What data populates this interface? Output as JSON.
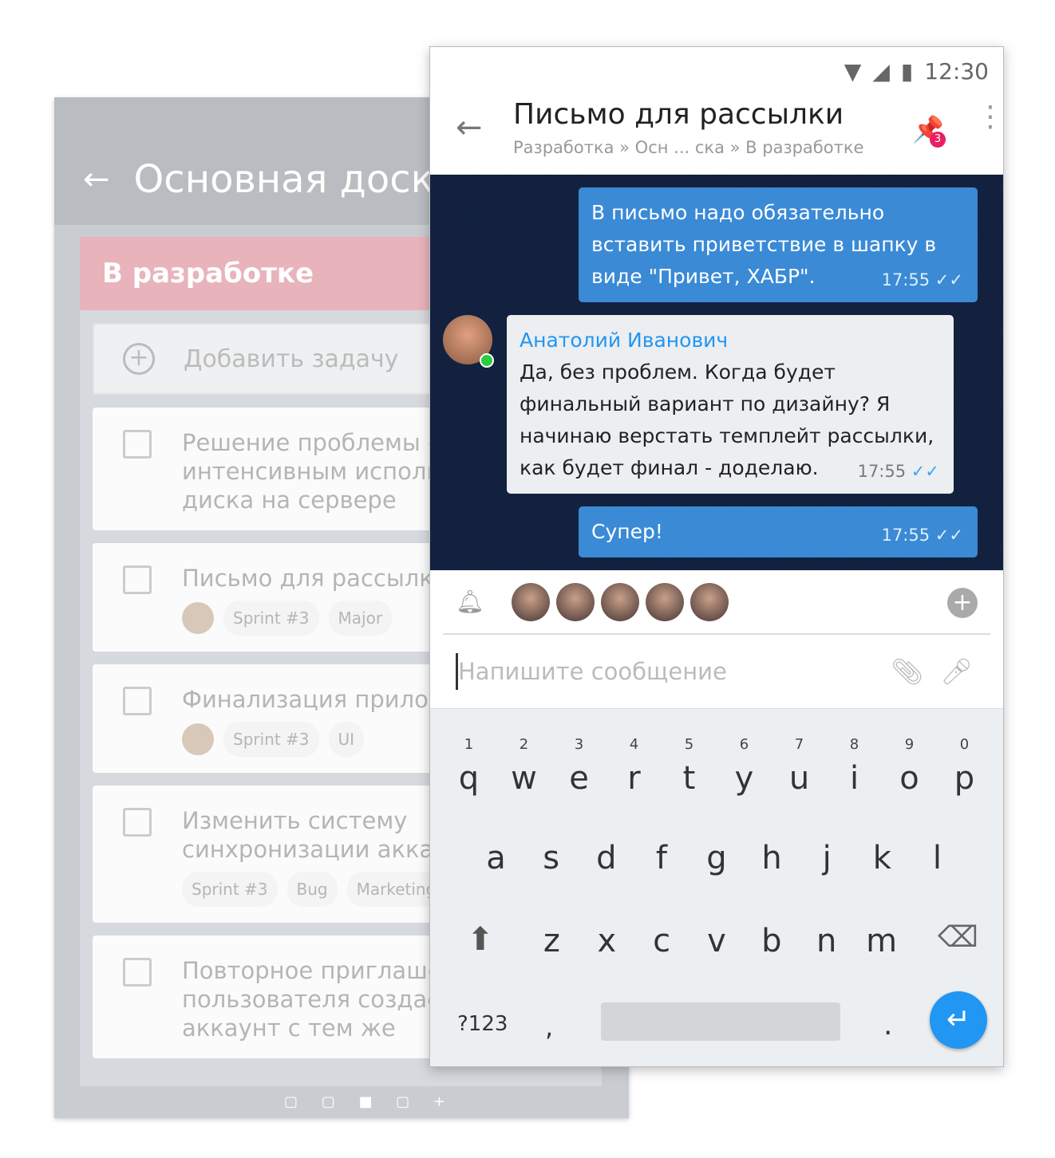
{
  "board": {
    "title": "Основная доска",
    "column": "В разработке",
    "add_task": "Добавить задачу",
    "cards": [
      {
        "title": "Решение проблемы с слишком интенсивным использованием диска на сервере",
        "tags": []
      },
      {
        "title": "Письмо для рассылки",
        "tags": [
          "Sprint #3",
          "Major"
        ]
      },
      {
        "title": "Финализация приложения",
        "tags": [
          "Sprint #3",
          "UI"
        ]
      },
      {
        "title": "Изменить систему синхронизации аккаунтов",
        "tags": [
          "Sprint #3",
          "Bug",
          "Marketing"
        ]
      },
      {
        "title": "Повторное приглашение пользователя создаёт новый аккаунт с тем же",
        "tags": []
      }
    ],
    "pager": "▢ ▢ ■ ▢ +"
  },
  "status": {
    "time": "12:30"
  },
  "header": {
    "title": "Письмо для рассылки",
    "breadcrumb": "Разработка » Осн ... ска » В разработке",
    "pin_count": "3"
  },
  "messages": [
    {
      "dir": "out",
      "text": "В письмо надо обязательно вставить приветствие в шапку в виде \"Привет,  ХАБР\".",
      "time": "17:55"
    },
    {
      "dir": "in",
      "author": "Анатолий Иванович",
      "text": "Да, без проблем. Когда будет финальный вариант по дизайну? Я начинаю верстать темплейт рассылки, как будет финал - доделаю.",
      "time": "17:55"
    },
    {
      "dir": "out",
      "text": "Супер!",
      "time": "17:55"
    }
  ],
  "composer": {
    "placeholder": "Напишите сообщение"
  },
  "keyboard": {
    "row1": [
      "q",
      "w",
      "e",
      "r",
      "t",
      "y",
      "u",
      "i",
      "o",
      "p"
    ],
    "nums": [
      "1",
      "2",
      "3",
      "4",
      "5",
      "6",
      "7",
      "8",
      "9",
      "0"
    ],
    "row2": [
      "a",
      "s",
      "d",
      "f",
      "g",
      "h",
      "j",
      "k",
      "l"
    ],
    "row3": [
      "z",
      "x",
      "c",
      "v",
      "b",
      "n",
      "m"
    ],
    "symbols": "?123",
    "comma": ",",
    "period": "."
  },
  "colors": {
    "accent": "#2196f3",
    "outgoing": "#3a8ad6",
    "badge": "#e91e63",
    "column_header": "#e8b3bb"
  }
}
